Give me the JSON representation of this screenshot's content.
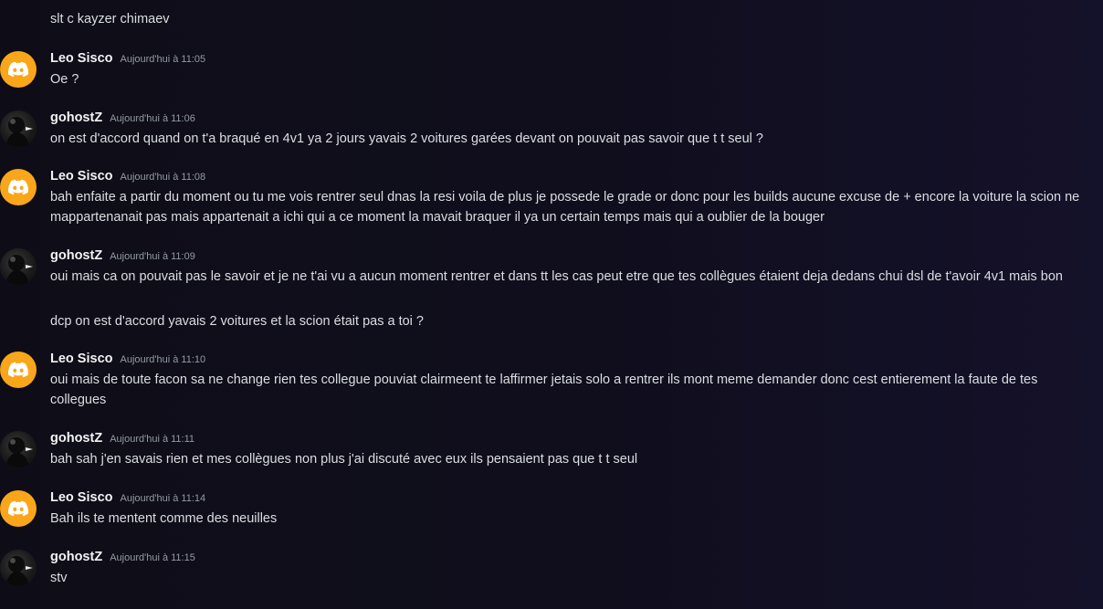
{
  "messages": [
    {
      "continuation": true,
      "text": "slt c kayzer chimaev"
    },
    {
      "author": "Leo Sisco",
      "avatar": "discord-logo-icon",
      "timestamp": "Aujourd'hui à 11:05",
      "lines": [
        "Oe ?"
      ]
    },
    {
      "author": "gohostZ",
      "avatar": "user-avatar",
      "timestamp": "Aujourd'hui à 11:06",
      "lines": [
        "on est d'accord quand on t'a braqué en 4v1 ya 2 jours yavais 2 voitures garées devant on pouvait pas savoir que t t seul ?"
      ]
    },
    {
      "author": "Leo Sisco",
      "avatar": "discord-logo-icon",
      "timestamp": "Aujourd'hui à 11:08",
      "lines": [
        "bah enfaite a partir du moment ou tu me vois rentrer seul dnas la resi voila de plus je possede le grade or donc pour les builds aucune excuse de + encore la voiture la scion ne mappartenanait pas mais appartenait a ichi qui a ce moment la mavait braquer il ya un certain temps mais qui a oublier de la bouger"
      ]
    },
    {
      "author": "gohostZ",
      "avatar": "user-avatar",
      "timestamp": "Aujourd'hui à 11:09",
      "lines": [
        "oui mais ca on pouvait pas le savoir et je ne t'ai vu a aucun moment rentrer et dans tt les cas peut etre que tes collègues étaient deja dedans chui dsl de t'avoir 4v1 mais bon",
        "dcp on est d'accord yavais 2 voitures et la scion était pas a toi ?"
      ]
    },
    {
      "author": "Leo Sisco",
      "avatar": "discord-logo-icon",
      "timestamp": "Aujourd'hui à 11:10",
      "lines": [
        "oui mais de toute facon sa ne change rien tes collegue pouviat clairmeent te laffirmer jetais solo a rentrer ils mont meme demander donc cest entierement la faute de tes collegues"
      ]
    },
    {
      "author": "gohostZ",
      "avatar": "user-avatar",
      "timestamp": "Aujourd'hui à 11:11",
      "lines": [
        "bah sah j'en savais rien et mes collègues non plus j'ai discuté avec eux ils pensaient pas que t t seul"
      ]
    },
    {
      "author": "Leo Sisco",
      "avatar": "discord-logo-icon",
      "timestamp": "Aujourd'hui à 11:14",
      "lines": [
        "Bah ils te mentent comme des neuilles"
      ]
    },
    {
      "author": "gohostZ",
      "avatar": "user-avatar",
      "timestamp": "Aujourd'hui à 11:15",
      "lines": [
        "stv"
      ]
    }
  ]
}
